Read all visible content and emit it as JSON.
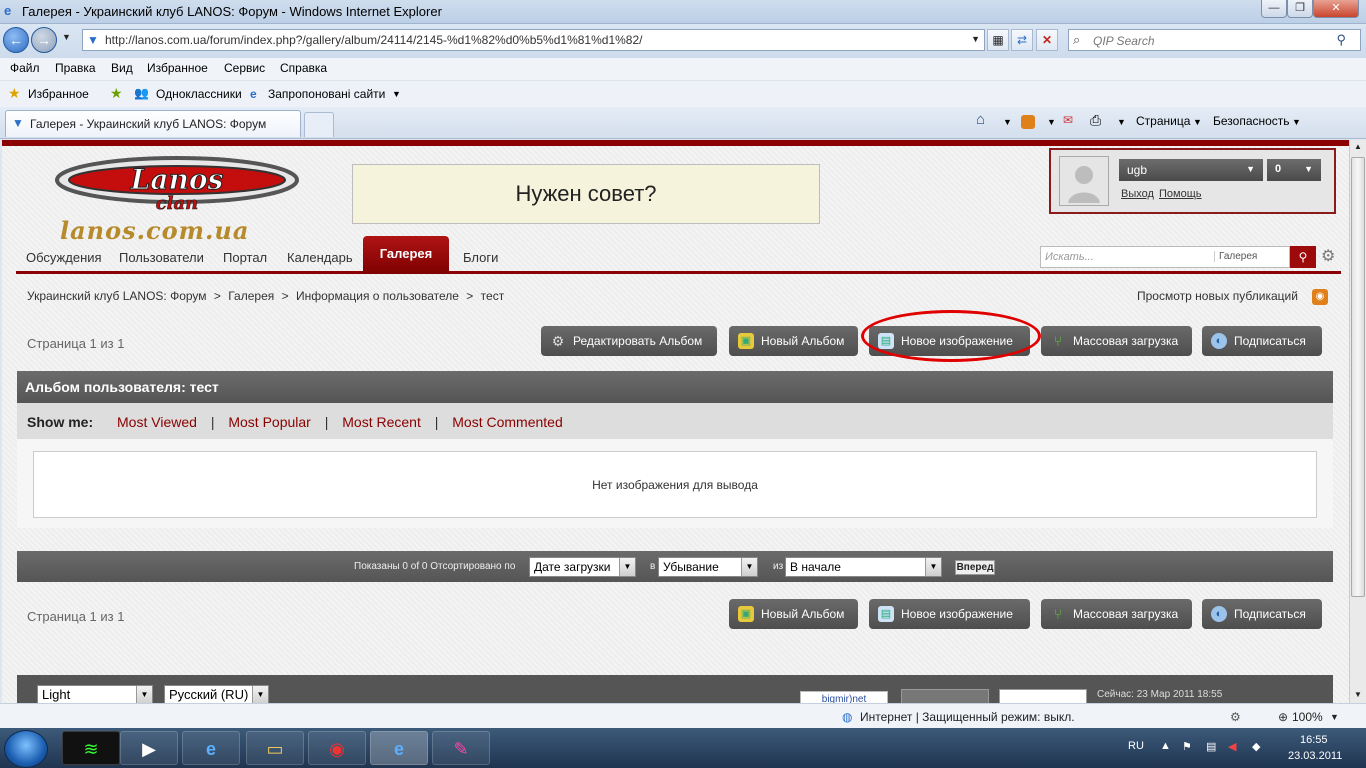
{
  "window": {
    "title": "Галерея - Украинский клуб LANOS: Форум - Windows Internet Explorer"
  },
  "browser": {
    "url": "http://lanos.com.ua/forum/index.php?/gallery/album/24114/2145-%d1%82%d0%b5%d1%81%d1%82/",
    "search_placeholder": "QIP Search",
    "menu": [
      "Файл",
      "Правка",
      "Вид",
      "Избранное",
      "Сервис",
      "Справка"
    ],
    "favorites": {
      "label": "Избранное",
      "items": [
        "Одноклассники",
        "Запропоновані сайти"
      ]
    },
    "tab_title": "Галерея - Украинский клуб LANOS: Форум",
    "commands": {
      "page": "Страница",
      "security": "Безопасность"
    },
    "status": {
      "zone": "Интернет | Защищенный режим: выкл.",
      "zoom": "100%"
    }
  },
  "site": {
    "banner": "Нужен совет?",
    "logo_text": "lanos.com.ua",
    "user": {
      "name": "ugb",
      "count": "0",
      "logout": "Выход",
      "help": "Помощь"
    },
    "nav": [
      "Обсуждения",
      "Пользователи",
      "Портал",
      "Календарь",
      "Галерея",
      "Блоги"
    ],
    "search": {
      "placeholder": "Искать...",
      "scope": "Галерея"
    },
    "breadcrumb": [
      "Украинский клуб LANOS: Форум",
      "Галерея",
      "Информация о пользователе",
      "тест"
    ],
    "new_pubs": "Просмотр новых публикаций",
    "page_info": "Страница 1 из 1",
    "buttons": {
      "edit_album": "Редактировать Альбом",
      "new_album": "Новый Альбом",
      "new_image": "Новое изображение",
      "mass_upload": "Массовая загрузка",
      "subscribe": "Подписаться"
    },
    "album_title": "Альбом пользователя: тест",
    "show_me": {
      "label": "Show me:",
      "links": [
        "Most Viewed",
        "Most Popular",
        "Most Recent",
        "Most Commented"
      ]
    },
    "empty_msg": "Нет изображения для вывода",
    "sort": {
      "shown": "Показаны 0 of 0 Отсортировано по",
      "by": "Дате загрузки",
      "in": "в",
      "order": "Убывание",
      "from": "из",
      "start": "В начале",
      "go": "Вперед"
    },
    "footer": {
      "skin": "Light",
      "lang": "Русский (RU)",
      "counter": "bigmir)net",
      "now": "Сейчас: 23 Мар 2011 18:55"
    }
  },
  "taskbar": {
    "lang": "RU",
    "time": "16:55",
    "date": "23.03.2011"
  },
  "colors": {
    "accent": "#8b0000",
    "annotation": "#e00000"
  }
}
